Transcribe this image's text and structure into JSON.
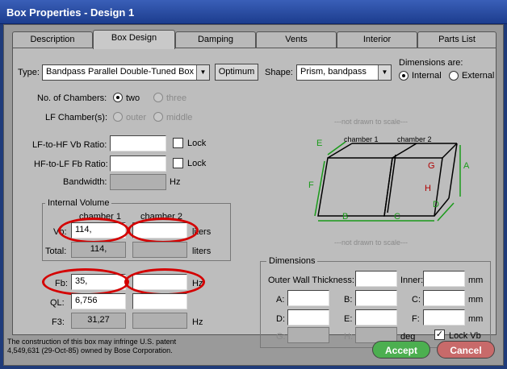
{
  "window": {
    "title": "Box Properties - Design 1"
  },
  "tabs": [
    "Description",
    "Box Design",
    "Damping",
    "Vents",
    "Interior",
    "Parts List"
  ],
  "type": {
    "label": "Type:",
    "value": "Bandpass Parallel Double-Tuned Box",
    "optimum": "Optimum"
  },
  "shape": {
    "label": "Shape:",
    "value": "Prism, bandpass"
  },
  "dims_are": {
    "label": "Dimensions are:",
    "internal": "Internal",
    "external": "External"
  },
  "chambers": {
    "label": "No. of Chambers:",
    "two": "two",
    "three": "three"
  },
  "lf_chamber": {
    "label": "LF Chamber(s):",
    "outer": "outer",
    "middle": "middle"
  },
  "ratios": {
    "vb_label": "LF-to-HF Vb Ratio:",
    "fb_label": "HF-to-LF Fb Ratio:",
    "lock": "Lock",
    "bandwidth": "Bandwidth:",
    "hz": "Hz"
  },
  "volume": {
    "title": "Internal Volume",
    "chamber1": "chamber 1",
    "chamber2": "chamber 2",
    "vb_label": "Vb:",
    "vb1": "114,",
    "vb2": "",
    "unit": "liters",
    "total_label": "Total:",
    "total": "114,"
  },
  "tuning": {
    "fb_label": "Fb:",
    "fb1": "35,",
    "fb2": "",
    "hz": "Hz",
    "ql_label": "QL:",
    "ql1": "6,756",
    "ql2": "",
    "f3_label": "F3:",
    "f3": "31,27"
  },
  "drawing": {
    "note": "---not drawn to scale---",
    "chamber1": "chamber 1",
    "chamber2": "chamber 2",
    "labels": [
      "E",
      "F",
      "B",
      "C",
      "D",
      "A",
      "G",
      "H"
    ]
  },
  "dimensions": {
    "title": "Dimensions",
    "wall": "Outer Wall Thickness:",
    "inner": "Inner:",
    "mm": "mm",
    "deg": "deg",
    "a": "A:",
    "b": "B:",
    "c": "C:",
    "d": "D:",
    "e": "E:",
    "f": "F:",
    "g": "G:",
    "h": "H:",
    "lock": "Lock Vb"
  },
  "footer": {
    "line1": "The construction of this box may infringe U.S. patent",
    "line2": "4,549,631 (29-Oct-85) owned by Bose Corporation."
  },
  "buttons": {
    "accept": "Accept",
    "cancel": "Cancel"
  },
  "colors": {
    "accept": "#4caf50",
    "cancel": "#c86a6a",
    "highlight": "#d40000",
    "diagram_green": "#1a9a1a"
  }
}
